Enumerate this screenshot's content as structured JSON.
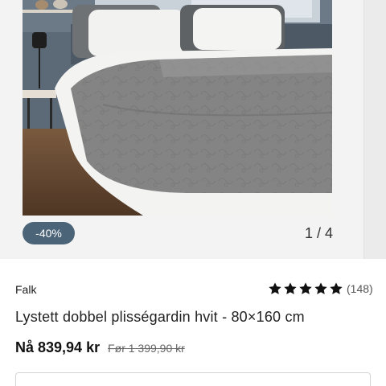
{
  "gallery": {
    "discount_badge": "-40%",
    "slide_counter": "1 / 4",
    "image_subject": "bedroom-with-grey-quilted-bedspread"
  },
  "product": {
    "brand": "Falk",
    "rating_stars": 5,
    "rating_count": "(148)",
    "title": "Lystett dobbel plisségardin hvit - 80×160 cm",
    "price": "Nå 839,94 kr",
    "old_price": "Før 1 399,90 kr"
  },
  "colors": {
    "badge_bg": "#4b6478",
    "star": "#111111",
    "text": "#1a1a1a"
  }
}
